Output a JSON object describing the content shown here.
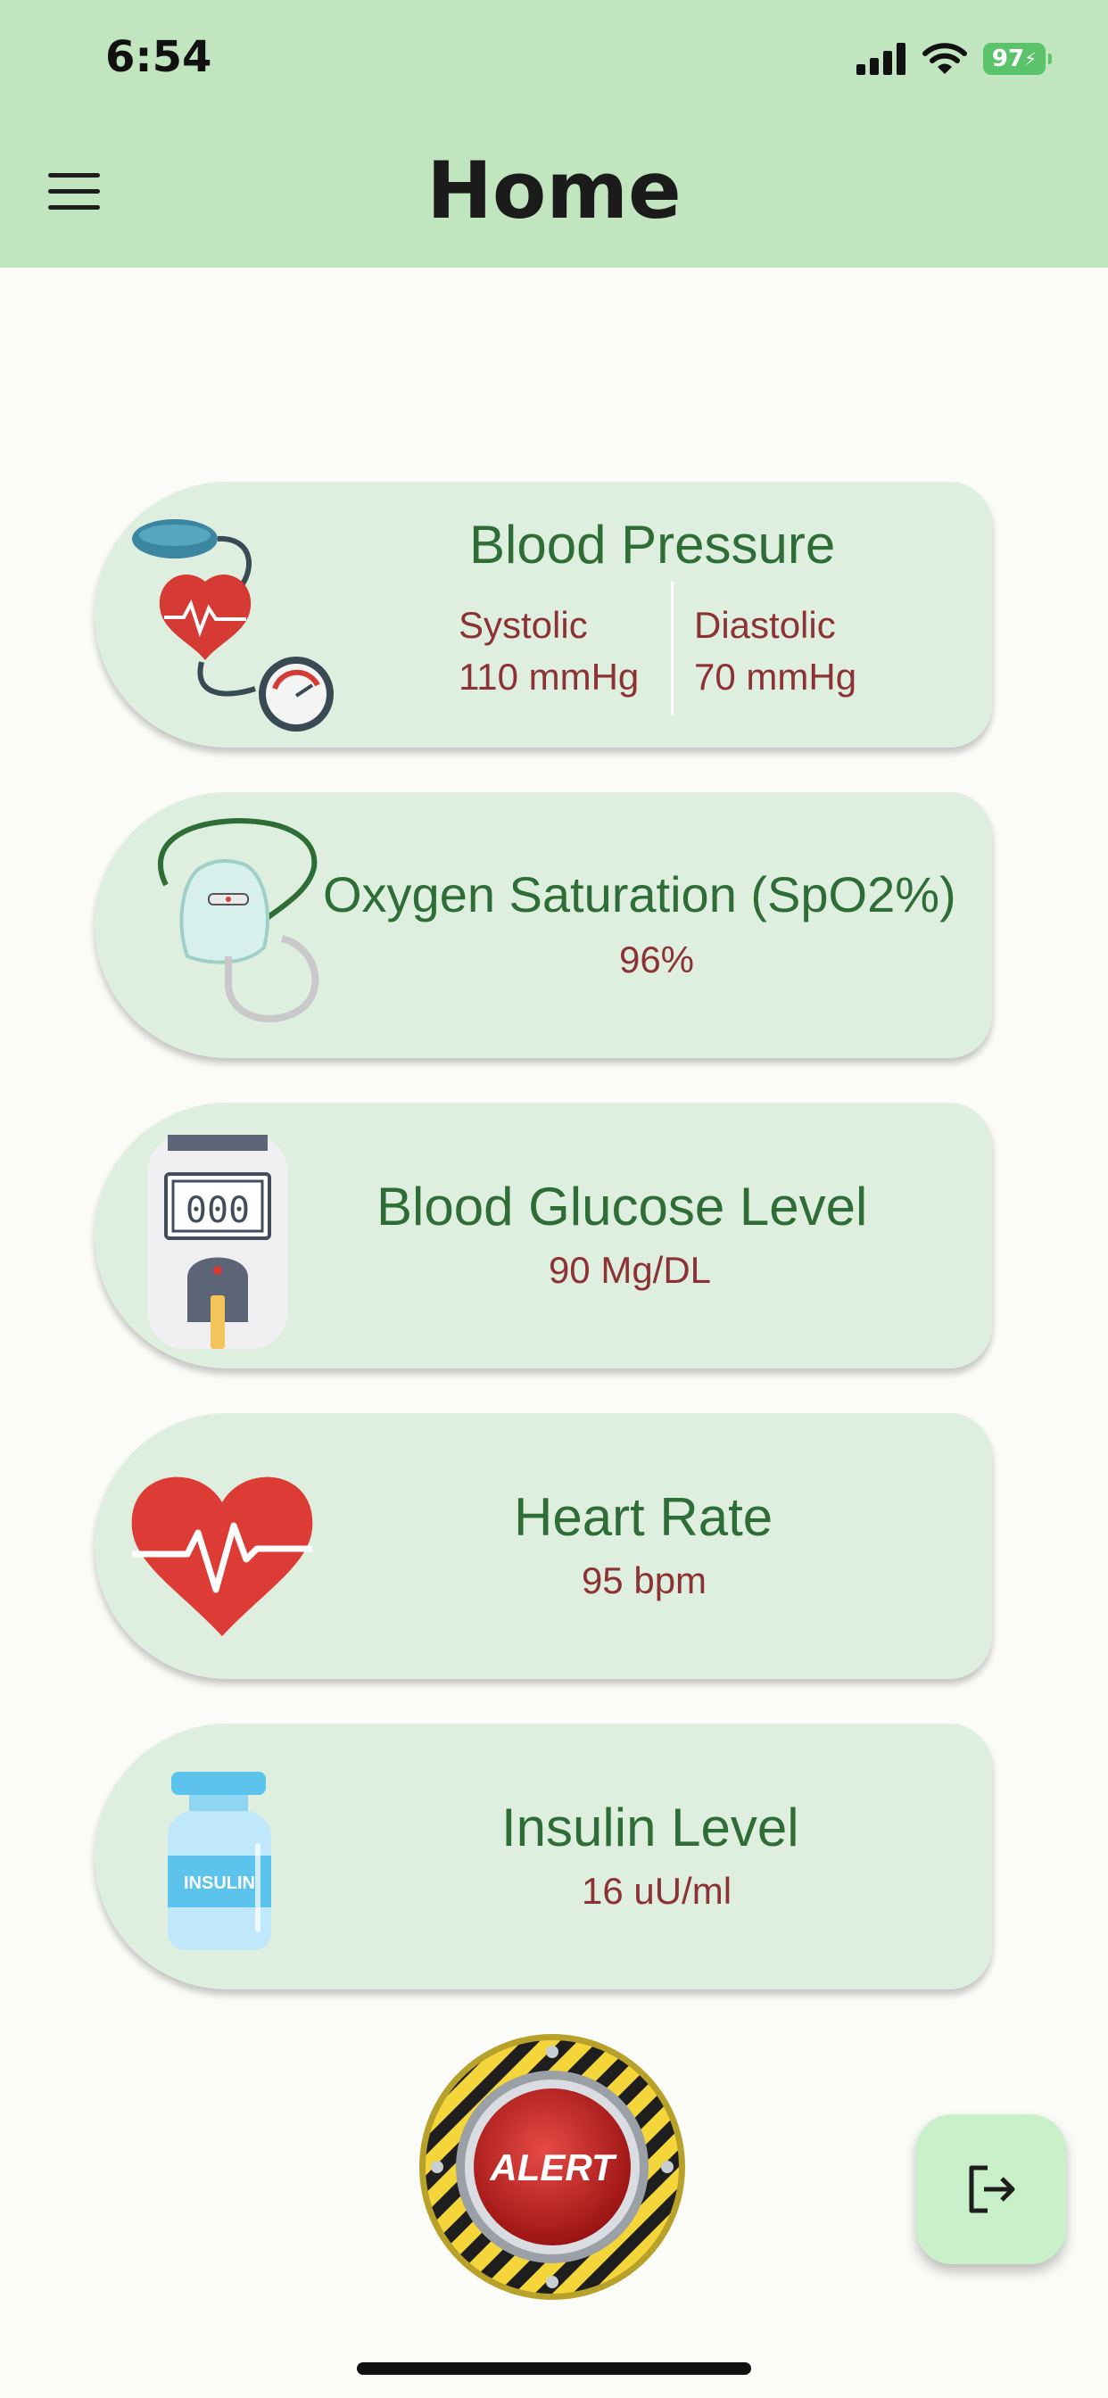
{
  "status_bar": {
    "time": "6:54",
    "battery": "97"
  },
  "header": {
    "title": "Home"
  },
  "cards": {
    "blood_pressure": {
      "title": "Blood Pressure",
      "systolic_label": "Systolic",
      "systolic_value": "110 mmHg",
      "diastolic_label": "Diastolic",
      "diastolic_value": "70 mmHg",
      "icon": "blood-pressure-monitor-icon"
    },
    "oxygen": {
      "title": "Oxygen Saturation (SpO2%)",
      "value": "96%",
      "icon": "oxygen-mask-icon"
    },
    "glucose": {
      "title": "Blood Glucose Level",
      "value": "90 Mg/DL",
      "icon": "glucometer-icon",
      "display": "000"
    },
    "heart_rate": {
      "title": "Heart Rate",
      "value": "95 bpm",
      "icon": "heart-pulse-icon"
    },
    "insulin": {
      "title": "Insulin Level",
      "value": "16 uU/ml",
      "icon": "insulin-vial-icon",
      "vial_label": "INSULIN"
    }
  },
  "alert_button": {
    "label": "ALERT"
  },
  "logout_button": {
    "icon": "logout-icon"
  },
  "colors": {
    "header_bg": "#c1e6bf",
    "card_bg": "#dfefdf",
    "title_green": "#2f6d36",
    "value_red": "#8d3234",
    "fab_bg": "#c9f0c8"
  }
}
